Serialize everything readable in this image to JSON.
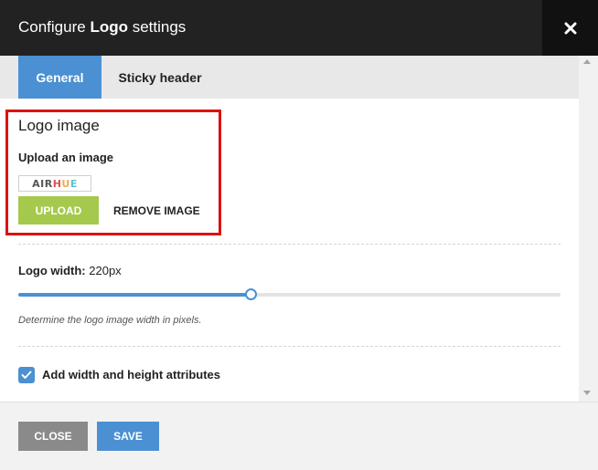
{
  "dialog": {
    "title_prefix": "Configure ",
    "title_bold": "Logo",
    "title_suffix": " settings",
    "close_glyph": "✕"
  },
  "tabs": [
    {
      "label": "General",
      "active": true
    },
    {
      "label": "Sticky header",
      "active": false
    }
  ],
  "logo_image": {
    "section_title": "Logo image",
    "upload_label": "Upload an image",
    "thumbnail_text": {
      "a": "AIR",
      "h": "H",
      "u": "U",
      "e": "E"
    },
    "upload_button": "UPLOAD",
    "remove_button": "REMOVE IMAGE"
  },
  "logo_width": {
    "label": "Logo width:",
    "value": "220px",
    "slider_fraction": 0.43,
    "help_text": "Determine the logo image width in pixels."
  },
  "attributes_checkbox": {
    "label": "Add width and height attributes",
    "checked": true
  },
  "footer": {
    "close_label": "CLOSE",
    "save_label": "SAVE"
  },
  "colors": {
    "accent": "#4a90d2",
    "upload": "#a5c94c",
    "highlight": "#dd1111",
    "header_bg": "#222222"
  },
  "icons": {
    "close": "close-icon",
    "check": "checkmark-icon",
    "scroll_up": "chevron-up-icon",
    "scroll_down": "chevron-down-icon"
  }
}
